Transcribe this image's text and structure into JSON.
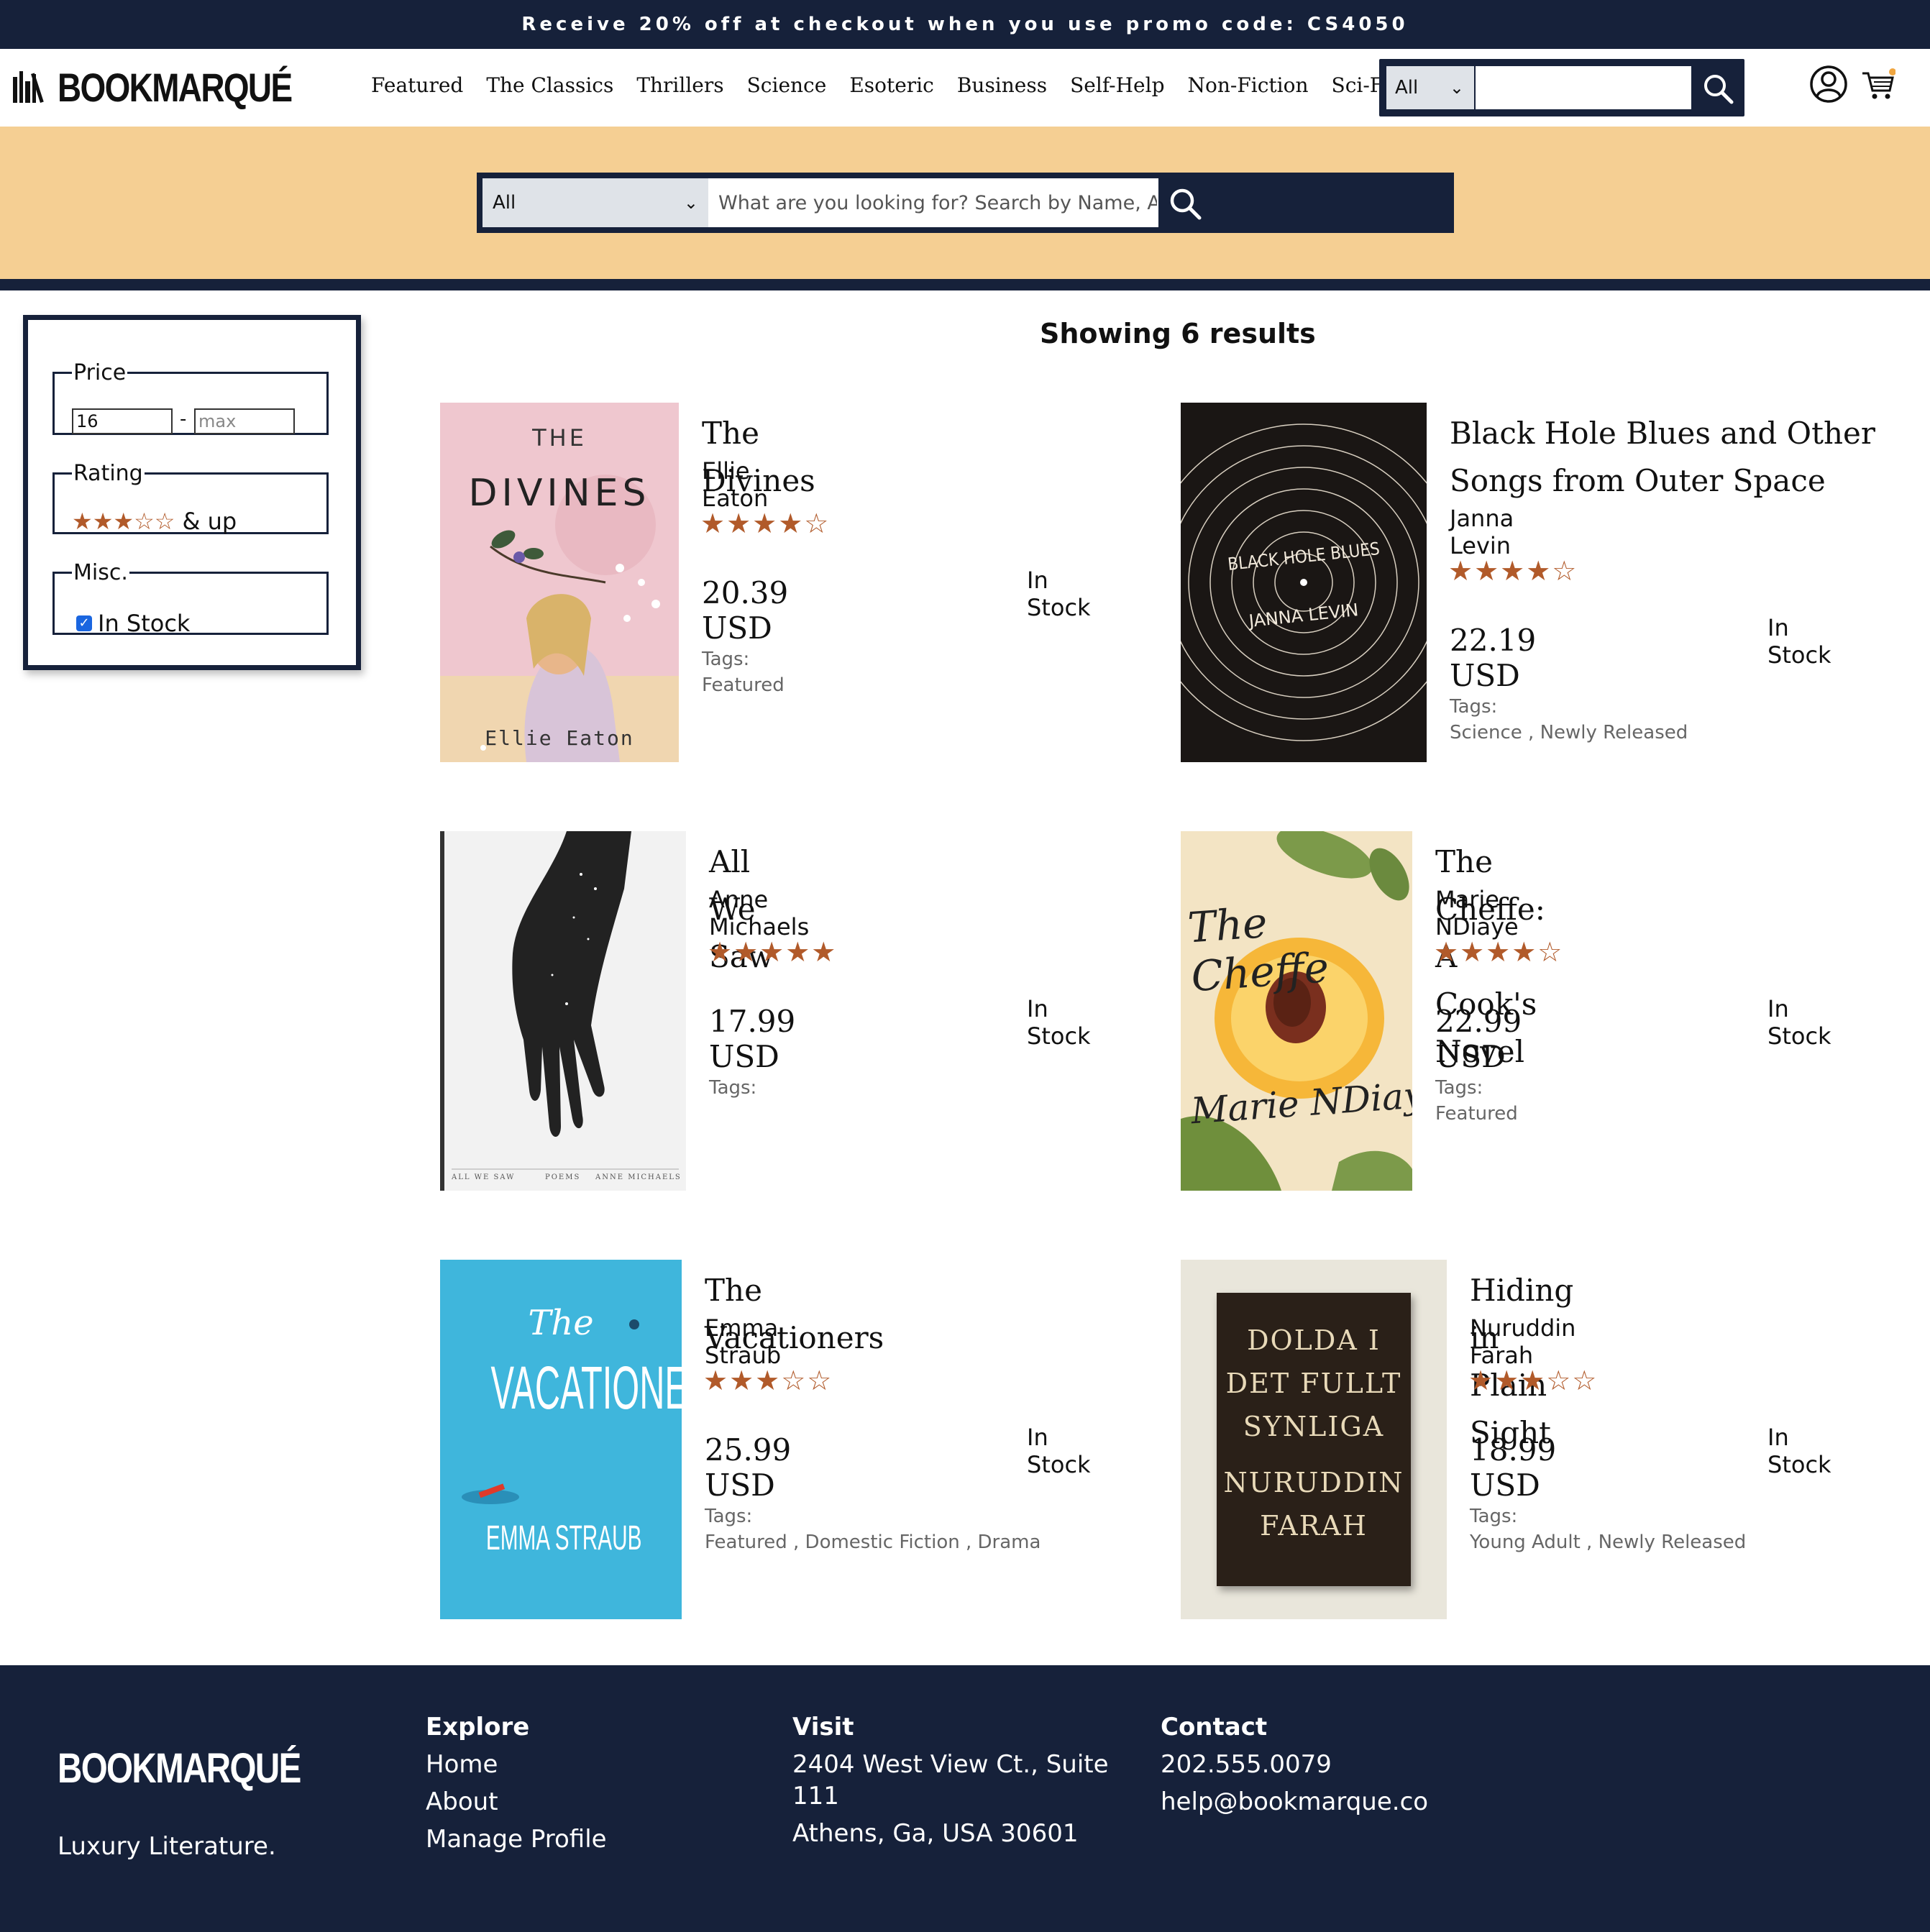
{
  "promo": "Receive 20% off at checkout when you use promo code: CS4050",
  "brand": {
    "name": "BOOKMARQUÉ",
    "tagline": "Luxury Literature."
  },
  "nav": [
    "Featured",
    "The Classics",
    "Thrillers",
    "Science",
    "Esoteric",
    "Business",
    "Self-Help",
    "Non-Fiction",
    "Sci-Fi"
  ],
  "header_search": {
    "category": "All",
    "value": ""
  },
  "big_search": {
    "category": "All",
    "placeholder": "What are you looking for? Search by Name, Author, Subject, & ISBN."
  },
  "filters": {
    "price": {
      "legend": "Price",
      "min": "16",
      "separator": "-",
      "max_placeholder": "max"
    },
    "rating": {
      "legend": "Rating",
      "stars": 3,
      "suffix": "& up"
    },
    "misc": {
      "legend": "Misc.",
      "in_stock_label": "In Stock",
      "in_stock_checked": true
    }
  },
  "results_title": "Showing 6 results",
  "colors": {
    "navy": "#16213a",
    "hero": "#f5cf93",
    "star": "#b15a2a"
  },
  "products": [
    {
      "title": "The Divines",
      "author": "Ellie Eaton",
      "rating": 4,
      "price": "20.39 USD",
      "stock": "In Stock",
      "tags_label": "Tags:",
      "tags": "Featured",
      "cover": {
        "line1": "THE",
        "line2": "DIVINES",
        "line3": "Ellie Eaton"
      }
    },
    {
      "title": "Black Hole Blues and Other Songs from Outer Space",
      "author": "Janna Levin",
      "rating": 4,
      "price": "22.19 USD",
      "stock": "In Stock",
      "tags_label": "Tags:",
      "tags": "Science , Newly Released",
      "cover": {
        "line1": "BLACK HOLE BLUES",
        "line2": "JANNA LEVIN"
      }
    },
    {
      "title": "All We Saw",
      "author": "Anne Michaels",
      "rating": 5,
      "price": "17.99 USD",
      "stock": "In Stock",
      "tags_label": "Tags:",
      "tags": "",
      "cover": {
        "line1": "ALL WE SAW",
        "line2": "POEMS",
        "line3": "ANNE MICHAELS"
      }
    },
    {
      "title": "The Cheffe: A Cook's Novel",
      "author": "Marie NDiaye",
      "rating": 4,
      "price": "22.99 USD",
      "stock": "In Stock",
      "tags_label": "Tags:",
      "tags": "Featured",
      "cover": {
        "line1": "The Cheffe",
        "line2": "Marie NDiaye"
      }
    },
    {
      "title": "The Vacationers",
      "author": "Emma Straub",
      "rating": 3,
      "price": "25.99 USD",
      "stock": "In Stock",
      "tags_label": "Tags:",
      "tags": "Featured , Domestic Fiction , Drama",
      "cover": {
        "line1": "The",
        "line2": "VACATIONERS",
        "line3": "EMMA STRAUB"
      }
    },
    {
      "title": "Hiding in Plain Sight",
      "author": "Nuruddin Farah",
      "rating": 3,
      "price": "18.99 USD",
      "stock": "In Stock",
      "tags_label": "Tags:",
      "tags": "Young Adult , Newly Released",
      "cover": {
        "line1": "DOLDA I",
        "line2": "DET FULLT",
        "line3": "SYNLIGA",
        "line4": "NURUDDIN",
        "line5": "FARAH"
      }
    }
  ],
  "footer": {
    "explore": {
      "heading": "Explore",
      "links": [
        "Home",
        "About",
        "Manage Profile"
      ]
    },
    "visit": {
      "heading": "Visit",
      "line1": "2404 West View Ct., Suite",
      "line2": "111",
      "line3": "Athens, Ga, USA 30601"
    },
    "contact": {
      "heading": "Contact",
      "phone": "202.555.0079",
      "email": "help@bookmarque.co"
    }
  }
}
